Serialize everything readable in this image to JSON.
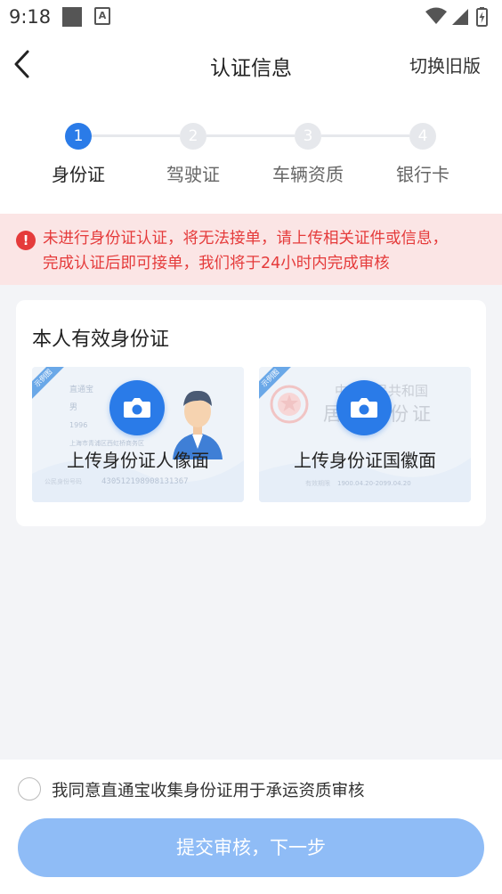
{
  "status_bar": {
    "time": "9:18",
    "a_icon_text": "A"
  },
  "header": {
    "title": "认证信息",
    "switch_label": "切换旧版"
  },
  "steps": [
    {
      "number": "1",
      "label": "身份证",
      "active": true
    },
    {
      "number": "2",
      "label": "驾驶证",
      "active": false
    },
    {
      "number": "3",
      "label": "车辆资质",
      "active": false
    },
    {
      "number": "4",
      "label": "银行卡",
      "active": false
    }
  ],
  "alert": {
    "line1": "未进行身份证认证，将无法接单，请上传相关证件或信息，",
    "line2": "完成认证后即可接单，我们将于24小时内完成审核",
    "color": "#e53b3b"
  },
  "card": {
    "title": "本人有效身份证",
    "front": {
      "label": "上传身份证人像面",
      "sample_tag": "示例图",
      "name": "直通宝",
      "gender": "男",
      "birth_year": "1996",
      "address": "上海市青浦区西虹桥商务区",
      "id_label": "公民身份号码",
      "id_number": "430512198908131367"
    },
    "back": {
      "label": "上传身份证国徽面",
      "sample_tag": "示例图",
      "header_text": "中华人民共和国",
      "title_text": "居民身份证",
      "validity_label": "有效期限",
      "validity_value": "1900.04.20-2099.04.20"
    }
  },
  "agreement": {
    "text": "我同意直通宝收集身份证用于承运资质审核",
    "checked": false
  },
  "submit": {
    "label": "提交审核，下一步"
  },
  "colors": {
    "primary": "#2a7be8",
    "button_disabled": "#8fbcf6",
    "background": "#f3f4f7"
  }
}
